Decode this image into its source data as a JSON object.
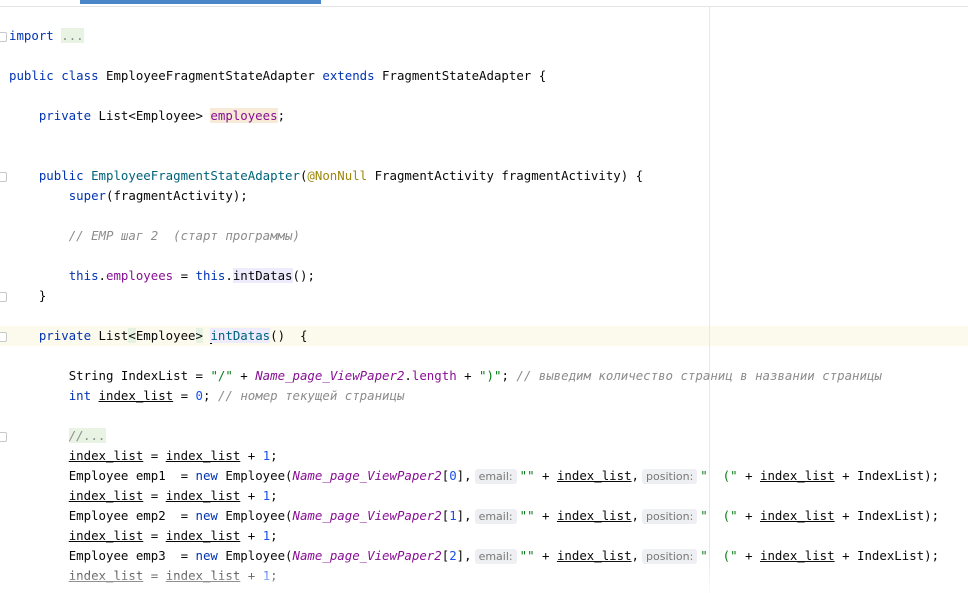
{
  "editor": {
    "lines": {
      "l1": {
        "kw": "import",
        "collapsed": "..."
      },
      "l2": {
        "k1": "public",
        "k2": "class",
        "name": "EmployeeFragmentStateAdapter",
        "k3": "extends",
        "parent": "FragmentStateAdapter",
        "brace": " {"
      },
      "l3": {
        "k1": "private",
        "type": " List<Employee> ",
        "field": "employees",
        "end": ";"
      },
      "l4": {
        "k1": "public",
        "ctor": "EmployeeFragmentStateAdapter",
        "open": "(",
        "ann": "@NonNull",
        "params": " FragmentActivity fragmentActivity) {"
      },
      "l5": {
        "fn": "super",
        "rest": "(fragmentActivity);"
      },
      "l6": {
        "comment": "// EMP шаг 2  (старт программы)"
      },
      "l7": {
        "k1": "this",
        "dot1": ".",
        "field": "employees",
        "mid": " = ",
        "k2": "this",
        "dot2": ".",
        "method": "intDatas",
        "end": "();"
      },
      "l8": {
        "text": "}"
      },
      "l9": {
        "k1": "private",
        "t1": " List",
        "lt": "<",
        "t2": "Employee",
        "gt": ">",
        "sp": " ",
        "method": "intDatas",
        "end": "()  {"
      },
      "l10": {
        "t1": "String IndexList = ",
        "s1": "\"/\"",
        "p1": " + ",
        "stat": "Name_page_ViewPaper2",
        "p2": ".",
        "fld": "length",
        "p3": " + ",
        "s2": "\")\"",
        "p4": "; ",
        "comment": "// выведим количество страниц в названии страницы"
      },
      "l11": {
        "kw": "int",
        "sp": " ",
        "var": "index_list",
        "eq": " = ",
        "num": "0",
        "sc": "; ",
        "comment": "// номер текущей страницы"
      },
      "l12": {
        "collapsed": "//..."
      },
      "l13": {
        "v1": "index_list",
        "eq": " = ",
        "v2": "index_list",
        "plus": " + ",
        "num": "1",
        "sc": ";"
      },
      "l14": {
        "decl": "Employee emp1  = ",
        "kw": "new",
        "ctor": " Employee(",
        "stat": "Name_page_ViewPaper2",
        "idx_open": "[",
        "idx": "0",
        "idx_close": "],",
        "hint_email": "email:",
        "str_empty": "\"\"",
        "plus1": " + ",
        "var": "index_list",
        "comma": ",",
        "hint_position": "position:",
        "str_open": "\"  (\"",
        "plus2": " + ",
        "var2": "index_list",
        "tail": " + IndexList);"
      },
      "l15": {
        "v1": "index_list",
        "eq": " = ",
        "v2": "index_list",
        "plus": " + ",
        "num": "1",
        "sc": ";"
      },
      "l16": {
        "decl": "Employee emp2  = ",
        "kw": "new",
        "ctor": " Employee(",
        "stat": "Name_page_ViewPaper2",
        "idx_open": "[",
        "idx": "1",
        "idx_close": "],",
        "hint_email": "email:",
        "str_empty": "\"\"",
        "plus1": " + ",
        "var": "index_list",
        "comma": ",",
        "hint_position": "position:",
        "str_open": "\"  (\"",
        "plus2": " + ",
        "var2": "index_list",
        "tail": " + IndexList);"
      },
      "l17": {
        "v1": "index_list",
        "eq": " = ",
        "v2": "index_list",
        "plus": " + ",
        "num": "1",
        "sc": ";"
      },
      "l18": {
        "decl": "Employee emp3  = ",
        "kw": "new",
        "ctor": " Employee(",
        "stat": "Name_page_ViewPaper2",
        "idx_open": "[",
        "idx": "2",
        "idx_close": "],",
        "hint_email": "email:",
        "str_empty": "\"\"",
        "plus1": " + ",
        "var": "index_list",
        "comma": ",",
        "hint_position": "position:",
        "str_open": "\"  (\"",
        "plus2": " + ",
        "var2": "index_list",
        "tail": " + IndexList);"
      },
      "l19": {
        "v1": "index_list",
        "eq": " = ",
        "v2": "index_list",
        "plus": " + ",
        "num": "1",
        "sc": ";"
      }
    }
  },
  "colors": {
    "keyword": "#0033b3",
    "field": "#871094",
    "string": "#067d17",
    "comment": "#8c8c8c",
    "annotation": "#9e880d",
    "number": "#1750eb",
    "tab_accent": "#4a86c8"
  }
}
